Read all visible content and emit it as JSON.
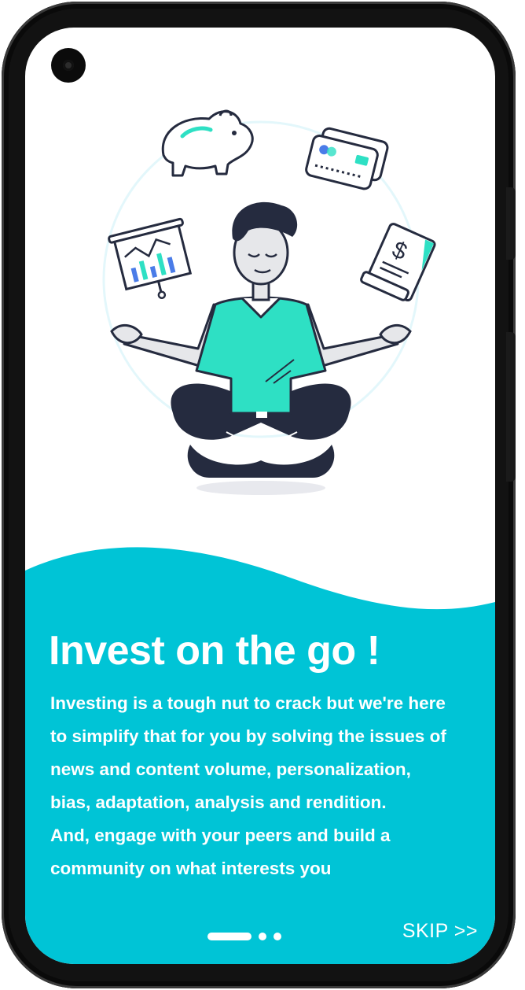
{
  "onboarding": {
    "headline": "Invest on the go !",
    "description_lines": [
      "Investing is a tough nut to crack but we're here",
      "to simplify that for you by solving the issues of",
      "news and content volume, personalization,",
      "bias, adaptation, analysis and rendition.",
      "And, engage with your peers and build a",
      "community on what interests you"
    ],
    "skip_label": "SKIP >>",
    "page_indicator": {
      "total": 3,
      "current": 1
    }
  },
  "illustration": {
    "subject": "meditating-investor",
    "floating_icons": [
      "piggy-bank-icon",
      "credit-cards-icon",
      "chart-board-icon",
      "dollar-document-icon"
    ]
  },
  "colors": {
    "accent": "#00C4D6",
    "sweater": "#2EE0C4",
    "dark": "#252B3F",
    "text_on_accent": "#FFFFFF"
  }
}
